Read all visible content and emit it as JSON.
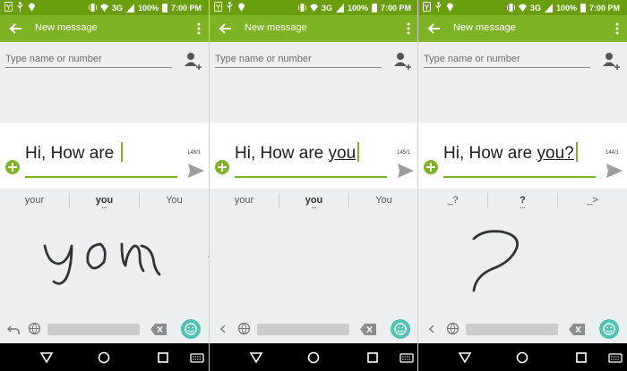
{
  "theme": {
    "statusbar": "#6a9e0e",
    "appbar": "#7db324",
    "accent": "#7db324",
    "emoji": "#4cc3b5"
  },
  "screens": [
    {
      "status": {
        "network": "3G",
        "battery": "100%",
        "time": "7:00 PM"
      },
      "appbar": {
        "title": "New message"
      },
      "recipient": {
        "placeholder": "Type name or number"
      },
      "message": {
        "text": "Hi, How are ",
        "underlined": "",
        "counter": "148/1"
      },
      "suggestions": [
        {
          "label": "your"
        },
        {
          "label": "you",
          "dots": "..."
        },
        {
          "label": "You"
        }
      ],
      "handwriting": "you",
      "keyboard_left_icon": "undo-icon"
    },
    {
      "status": {
        "network": "3G",
        "battery": "100%",
        "time": "7:00 PM"
      },
      "appbar": {
        "title": "New message"
      },
      "recipient": {
        "placeholder": "Type name or number"
      },
      "message": {
        "text": "Hi, How are ",
        "underlined": "you",
        "counter": "145/1"
      },
      "suggestions": [
        {
          "label": "your"
        },
        {
          "label": "you",
          "dots": "..."
        },
        {
          "label": "You"
        }
      ],
      "handwriting": "",
      "keyboard_left_icon": "chevron-left-icon"
    },
    {
      "status": {
        "network": "3G",
        "battery": "100%",
        "time": "7:00 PM"
      },
      "appbar": {
        "title": "New message"
      },
      "recipient": {
        "placeholder": "Type name or number"
      },
      "message": {
        "text": "Hi, How are ",
        "underlined": "you?",
        "counter": "144/1"
      },
      "suggestions": [
        {
          "label": "_?"
        },
        {
          "label": "?",
          "dots": "..."
        },
        {
          "label": "_>"
        }
      ],
      "handwriting": "?",
      "keyboard_left_icon": "chevron-left-icon"
    }
  ]
}
